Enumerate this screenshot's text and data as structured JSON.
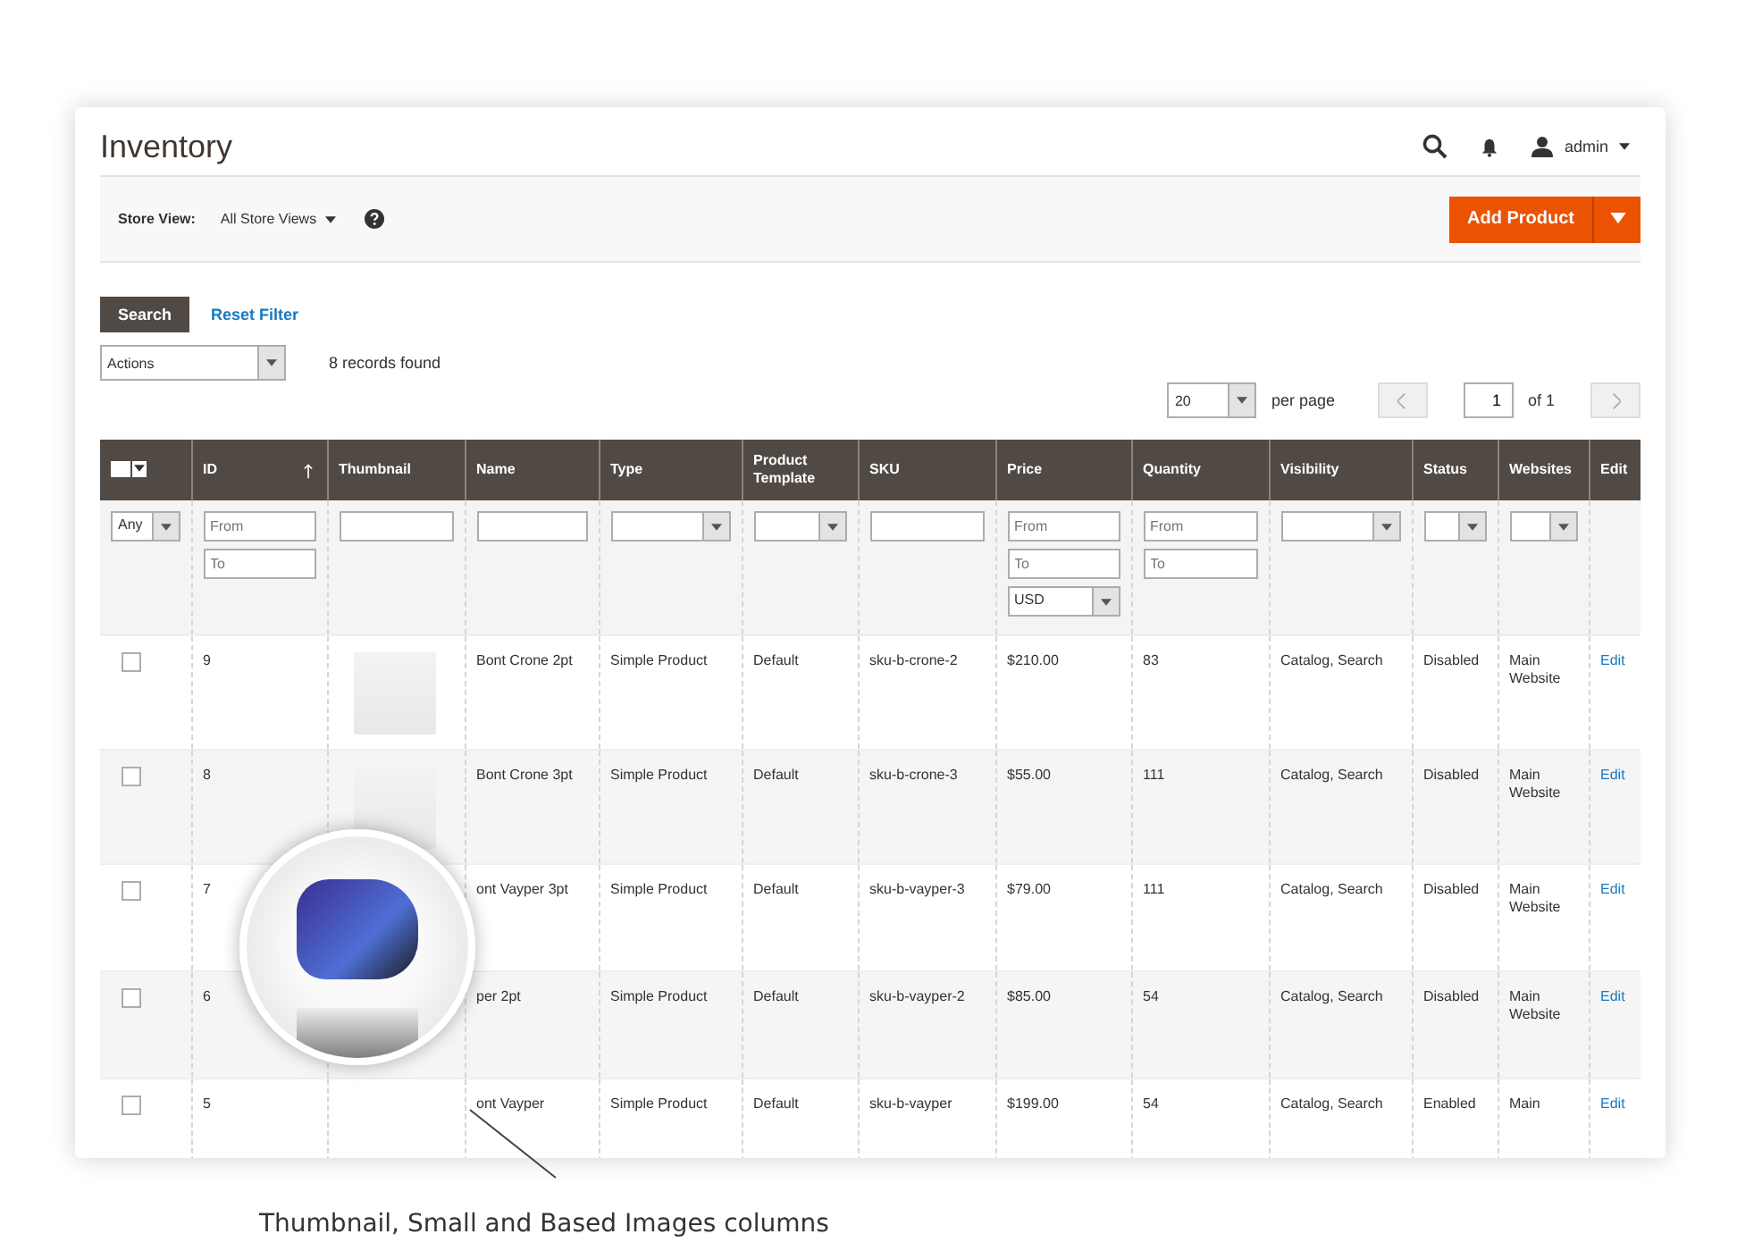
{
  "page_title": "Inventory",
  "header": {
    "user": "admin"
  },
  "toolbar": {
    "store_view_label": "Store View:",
    "store_view": "All Store Views",
    "add_button": "Add Product"
  },
  "search_button": "Search",
  "reset_filter": "Reset Filter",
  "actions": "Actions",
  "records_found": "8 records found",
  "pager": {
    "per_page_value": "20",
    "per_page_label": "per page",
    "page": "1",
    "of": "of 1"
  },
  "columns": [
    {
      "kind": "mass_select",
      "sorted": false,
      "filters": [
        {
          "kind": "select",
          "value": "Any"
        }
      ]
    },
    {
      "kind": "label",
      "label": "ID",
      "sorted": true,
      "filters": [
        {
          "kind": "input",
          "placeholder": "From"
        },
        {
          "kind": "input",
          "placeholder": "To"
        }
      ]
    },
    {
      "kind": "label",
      "label": "Thumbnail",
      "sorted": false,
      "filters": [
        {
          "kind": "input"
        }
      ]
    },
    {
      "kind": "label",
      "label": "Name",
      "sorted": false,
      "filters": [
        {
          "kind": "input"
        }
      ]
    },
    {
      "kind": "label",
      "label": "Type",
      "sorted": false,
      "filters": [
        {
          "kind": "select"
        }
      ]
    },
    {
      "kind": "label",
      "label": "Product Template",
      "sorted": false,
      "filters": [
        {
          "kind": "select"
        }
      ]
    },
    {
      "kind": "label",
      "label": "SKU",
      "sorted": false,
      "filters": [
        {
          "kind": "input"
        }
      ]
    },
    {
      "kind": "label",
      "label": "Price",
      "sorted": false,
      "filters": [
        {
          "kind": "input",
          "placeholder": "From"
        },
        {
          "kind": "input",
          "placeholder": "To"
        },
        {
          "kind": "select",
          "value": "USD"
        }
      ]
    },
    {
      "kind": "label",
      "label": "Quantity",
      "sorted": false,
      "filters": [
        {
          "kind": "input",
          "placeholder": "From"
        },
        {
          "kind": "input",
          "placeholder": "To"
        }
      ]
    },
    {
      "kind": "label",
      "label": "Visibility",
      "sorted": false,
      "filters": [
        {
          "kind": "select"
        }
      ]
    },
    {
      "kind": "label",
      "label": "Status",
      "sorted": false,
      "filters": [
        {
          "kind": "select"
        }
      ]
    },
    {
      "kind": "label",
      "label": "Websites",
      "sorted": false,
      "filters": [
        {
          "kind": "select"
        }
      ]
    },
    {
      "kind": "label",
      "label": "Edit",
      "sorted": false
    }
  ],
  "rows": [
    {
      "checked": false,
      "id": "9",
      "thumbnail_shown": true,
      "name": "Bont Crone 2pt",
      "type": "Simple Product",
      "template": "Default",
      "sku": "sku-b-crone-2",
      "price": "$210.00",
      "quantity": "83",
      "visibility": "Catalog, Search",
      "status": "Disabled",
      "websites": "Main Website",
      "edit": "Edit"
    },
    {
      "checked": false,
      "id": "8",
      "thumbnail_shown": true,
      "name": "Bont Crone 3pt",
      "type": "Simple Product",
      "template": "Default",
      "sku": "sku-b-crone-3",
      "price": "$55.00",
      "quantity": "111",
      "visibility": "Catalog, Search",
      "status": "Disabled",
      "websites": "Main Website",
      "edit": "Edit"
    },
    {
      "checked": false,
      "id": "7",
      "thumbnail_shown": false,
      "name": "ont Vayper 3pt",
      "type": "Simple Product",
      "template": "Default",
      "sku": "sku-b-vayper-3",
      "price": "$79.00",
      "quantity": "111",
      "visibility": "Catalog, Search",
      "status": "Disabled",
      "websites": "Main Website",
      "edit": "Edit"
    },
    {
      "checked": false,
      "id": "6",
      "thumbnail_shown": false,
      "name": "per 2pt",
      "type": "Simple Product",
      "template": "Default",
      "sku": "sku-b-vayper-2",
      "price": "$85.00",
      "quantity": "54",
      "visibility": "Catalog, Search",
      "status": "Disabled",
      "websites": "Main Website",
      "edit": "Edit"
    },
    {
      "checked": false,
      "id": "5",
      "thumbnail_shown": false,
      "name": "ont Vayper",
      "type": "Simple Product",
      "template": "Default",
      "sku": "sku-b-vayper",
      "price": "$199.00",
      "quantity": "54",
      "visibility": "Catalog, Search",
      "status": "Enabled",
      "websites": "Main",
      "edit": "Edit"
    }
  ],
  "caption": "Thumbnail, Small and Based Images columns"
}
